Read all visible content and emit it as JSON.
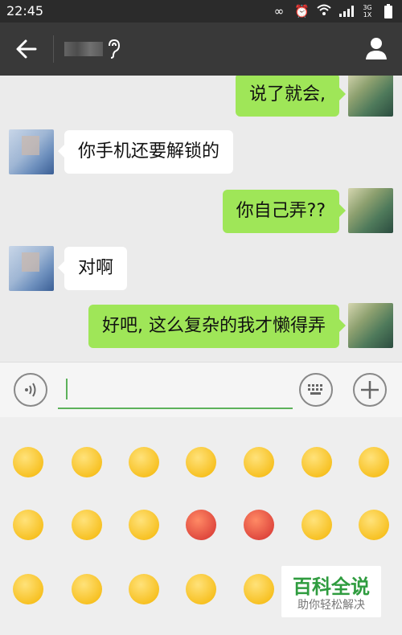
{
  "status_bar": {
    "time": "22:45",
    "network_label": "3G 1X"
  },
  "messages": [
    {
      "side": "right",
      "text": "说了就会,"
    },
    {
      "side": "left",
      "text": "你手机还要解锁的"
    },
    {
      "side": "right",
      "text": "你自己弄??"
    },
    {
      "side": "left",
      "text": "对啊"
    },
    {
      "side": "right",
      "text": "好吧, 这么复杂的我才懒得弄"
    }
  ],
  "input": {
    "value": "",
    "placeholder": ""
  },
  "emoji_rows": [
    [
      "smile-emoji",
      "bashful-emoji",
      "heart-eyes-emoji",
      "eye-roll-emoji",
      "cool-sunglasses-emoji",
      "crying-emoji",
      "star-eyes-emoji"
    ],
    [
      "shush-emoji",
      "sleepy-emoji",
      "sob-emoji",
      "angry-red-emoji",
      "furious-emoji",
      "wink-tongue-emoji",
      "grin-emoji"
    ],
    [
      "surprised-emoji",
      "sad-emoji",
      "shocked-emoji",
      "scream-emoji",
      "dizzy-emoji"
    ]
  ],
  "watermark": {
    "title": "百科全说",
    "subtitle": "助你轻松解决"
  },
  "colors": {
    "titlebar": "#393939",
    "statusbar": "#2b2b2b",
    "bubble_sent": "#9fe658",
    "bubble_received": "#ffffff",
    "accent": "#5cb15a"
  }
}
